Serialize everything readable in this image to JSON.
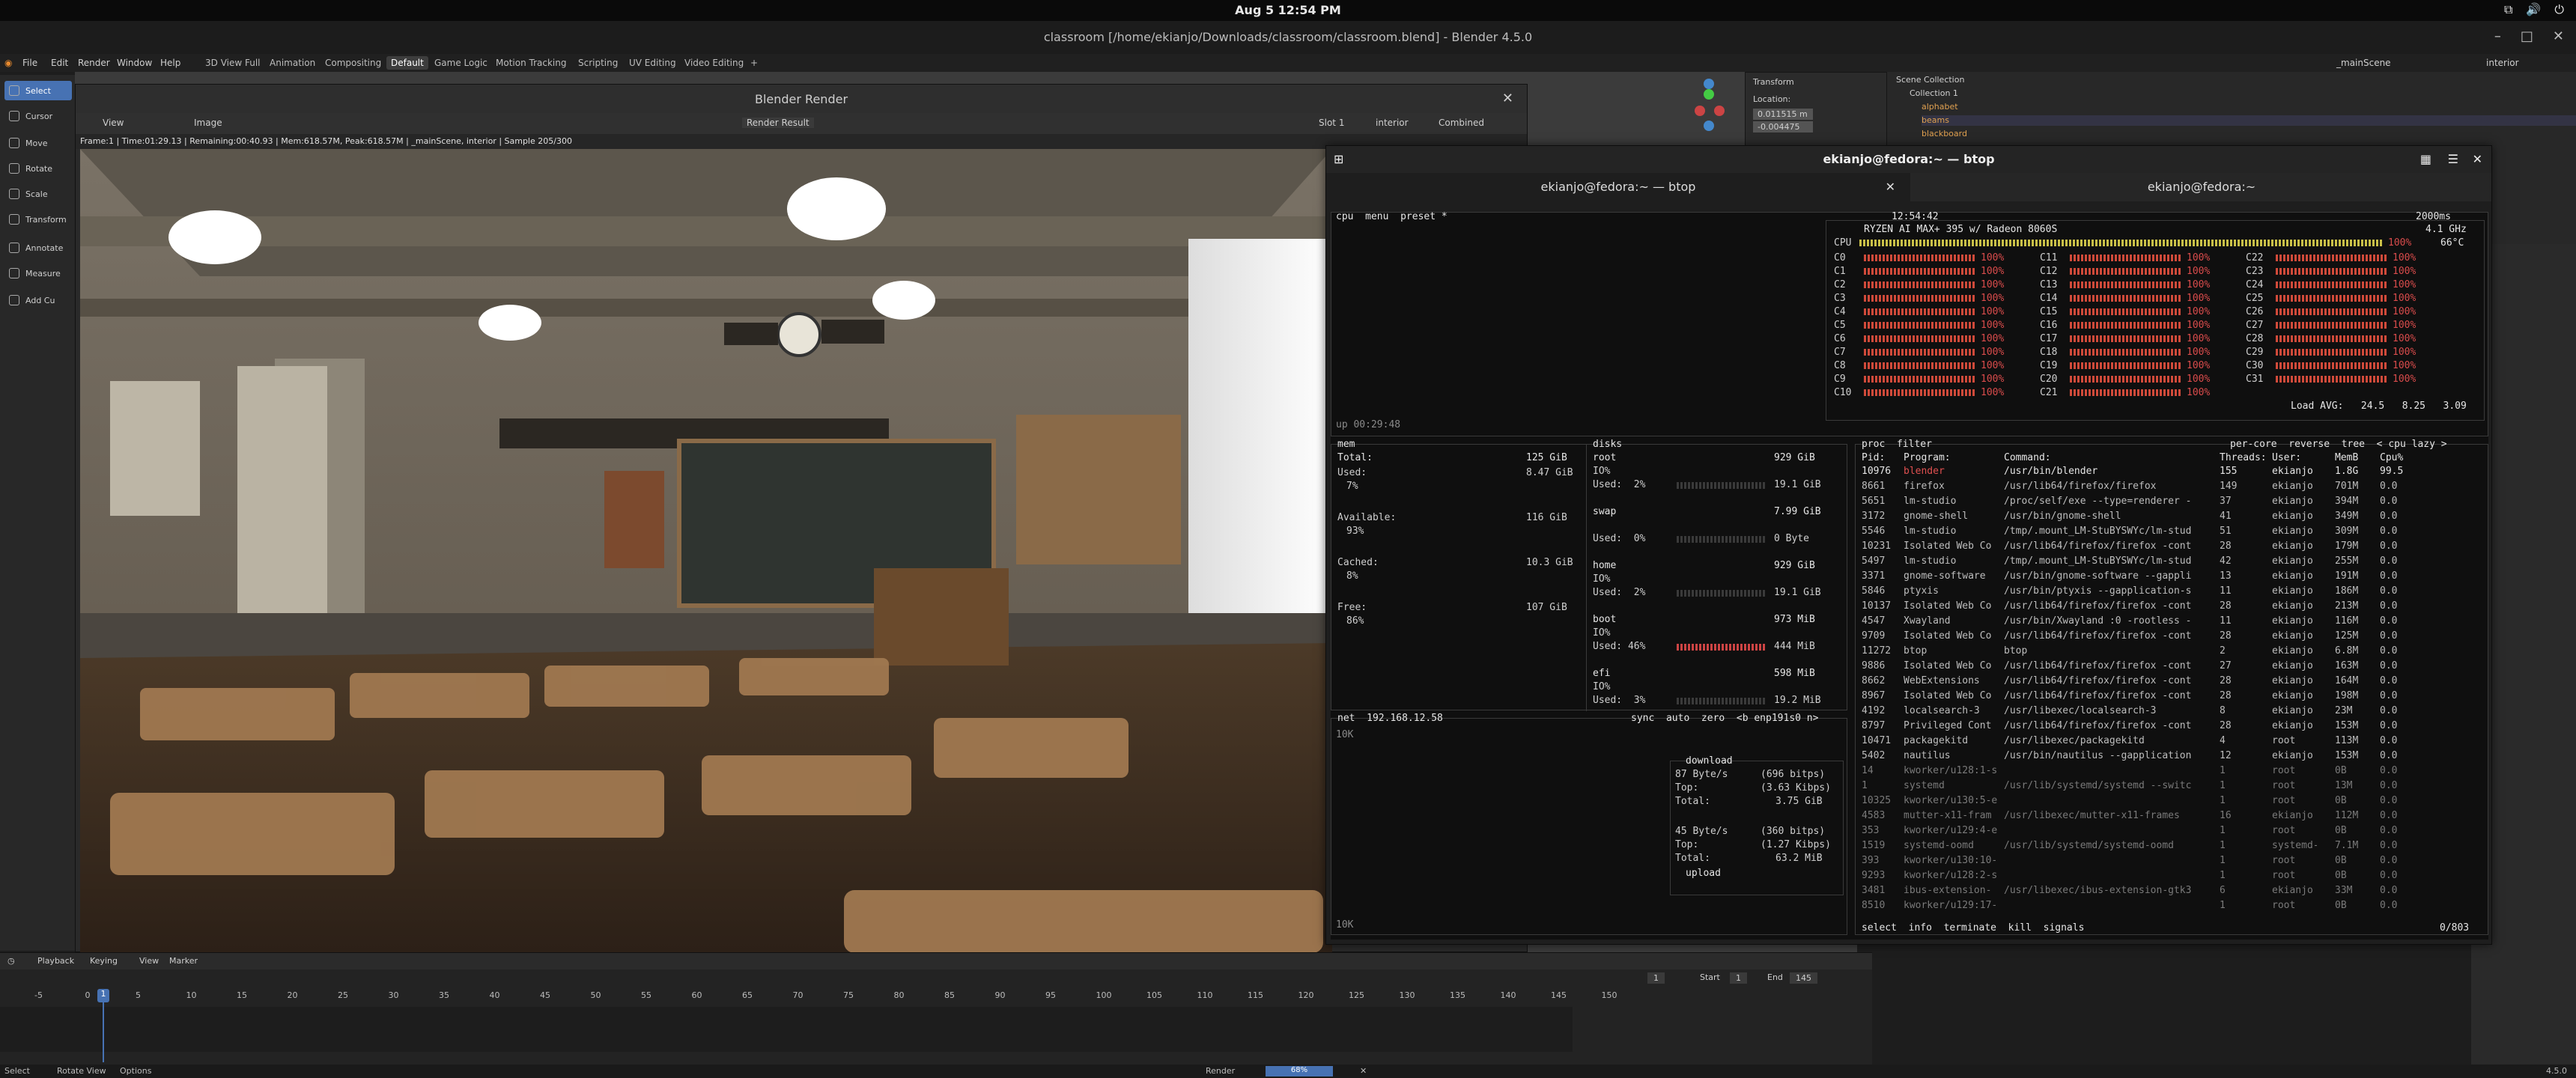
{
  "topbar": {
    "clock": "Aug 5  12:54 PM"
  },
  "blender": {
    "title": "classroom [/home/ekianjo/Downloads/classroom/classroom.blend] - Blender 4.5.0",
    "menu": [
      "File",
      "Edit",
      "Render",
      "Window",
      "Help"
    ],
    "workspaces": [
      "3D View Full",
      "Animation",
      "Compositing",
      "Default",
      "Game Logic",
      "Motion Tracking",
      "Scripting",
      "UV Editing",
      "Video Editing",
      "+"
    ],
    "active_workspace": "Default",
    "scene": "_mainScene",
    "layer": "interior",
    "tools": [
      "Select",
      "Cursor",
      "Move",
      "Rotate",
      "Scale",
      "Transform",
      "Annotate",
      "Measure",
      "Add Cu"
    ],
    "npanel": {
      "header": "Transform",
      "location": "Location:",
      "x": "0.011515 m",
      "y": "-0.004475"
    }
  },
  "render": {
    "title": "Blender Render",
    "view": "View",
    "image": "Image",
    "result": "Render Result",
    "slot": "Slot 1",
    "layer": "interior",
    "pass": "Combined",
    "info": "Frame:1 | Time:01:29.13 | Remaining:00:40.93 | Mem:618.57M, Peak:618.57M | _mainScene, interior | Sample 205/300"
  },
  "timeline": {
    "menu": [
      "Playback",
      "Keying",
      "View",
      "Marker"
    ],
    "current_frame": "1",
    "start_label": "Start",
    "start": "1",
    "end_label": "End",
    "end": "145",
    "ticks": [
      "-5",
      "0",
      "5",
      "10",
      "15",
      "20",
      "25",
      "30",
      "35",
      "40",
      "45",
      "50",
      "55",
      "60",
      "65",
      "70",
      "75",
      "80",
      "85",
      "90",
      "95",
      "100",
      "105",
      "110",
      "115",
      "120",
      "125",
      "130",
      "135",
      "140",
      "145",
      "150"
    ]
  },
  "status": {
    "select": "Select",
    "rotate": "Rotate View",
    "options": "Options",
    "render": "Render",
    "progress": "68%",
    "version": "4.5.0"
  },
  "outliner": {
    "title": "Scene Collection",
    "rows": [
      "Collection 1",
      "alphabet",
      "beams",
      "blackboard"
    ]
  },
  "terminal": {
    "title": "ekianjo@fedora:~ — btop",
    "tab1": "ekianjo@fedora:~ — btop",
    "tab2": "ekianjo@fedora:~",
    "cpu": {
      "header": "cpu  menu  preset *",
      "time": "12:54:42",
      "interval": "2000ms",
      "model": "RYZEN AI MAX+ 395 w/ Radeon 8060S",
      "freq": "4.1 GHz",
      "total": "100%",
      "temp": "66°C",
      "cores": [
        "C0",
        "C1",
        "C2",
        "C3",
        "C4",
        "C5",
        "C6",
        "C7",
        "C8",
        "C9",
        "C10",
        "C11",
        "C12",
        "C13",
        "C14",
        "C15",
        "C16",
        "C17",
        "C18",
        "C19",
        "C20",
        "C21",
        "C22",
        "C23",
        "C24",
        "C25",
        "C26",
        "C27",
        "C28",
        "C29",
        "C30",
        "C31"
      ],
      "core_pct": "100%",
      "load": "Load AVG:   24.5   8.25   3.09",
      "uptime": "up 00:29:48"
    },
    "mem": {
      "title": "mem",
      "total_l": "Total:",
      "total": "125 GiB",
      "used_l": "Used:",
      "used": "8.47 GiB",
      "used_p": "7%",
      "avail_l": "Available:",
      "avail": "116 GiB",
      "avail_p": "93%",
      "cached_l": "Cached:",
      "cached": "10.3 GiB",
      "cached_p": "8%",
      "free_l": "Free:",
      "free": "107 GiB",
      "free_p": "86%"
    },
    "disks": {
      "title": "disks",
      "rows": [
        {
          "name": "root",
          "size": "929 GiB",
          "io": "IO%",
          "used": "Used:  2%",
          "u": "19.1 GiB"
        },
        {
          "name": "swap",
          "size": "7.99 GiB",
          "io": "",
          "used": "Used:  0%",
          "u": "0 Byte"
        },
        {
          "name": "home",
          "size": "929 GiB",
          "io": "IO%",
          "used": "Used:  2%",
          "u": "19.1 GiB"
        },
        {
          "name": "boot",
          "size": "973 MiB",
          "io": "IO%",
          "used": "Used: 46%",
          "u": "444 MiB"
        },
        {
          "name": "efi",
          "size": "598 MiB",
          "io": "IO%",
          "used": "Used:  3%",
          "u": "19.2 MiB"
        }
      ]
    },
    "net": {
      "title": "net  192.168.12.58",
      "opts": "sync  auto  zero  <b enp191s0 n>",
      "scale_top": "10K",
      "scale_bot": "10K",
      "download": "download",
      "dl_rate": "87 Byte/s",
      "dl_bits": "(696 bitps)",
      "dl_top_l": "Top:",
      "dl_top": "(3.63 Kibps)",
      "dl_total_l": "Total:",
      "dl_total": "3.75 GiB",
      "ul_rate": "45 Byte/s",
      "ul_bits": "(360 bitps)",
      "ul_top_l": "Top:",
      "ul_top": "(1.27 Kibps)",
      "ul_total_l": "Total:",
      "ul_total": "63.2 MiB",
      "upload": "upload"
    },
    "proc": {
      "title": "proc  filter",
      "opts": "per-core  reverse  tree  < cpu lazy >",
      "headers": [
        "Pid:",
        "Program:",
        "Command:",
        "Threads:",
        "User:",
        "MemB",
        "Cpu%"
      ],
      "rows": [
        [
          "10976",
          "blender",
          "/usr/bin/blender",
          "155",
          "ekianjo",
          "1.8G",
          "99.5"
        ],
        [
          "8661",
          "firefox",
          "/usr/lib64/firefox/firefox",
          "149",
          "ekianjo",
          "701M",
          "0.0"
        ],
        [
          "5651",
          "lm-studio",
          "/proc/self/exe --type=renderer -",
          "37",
          "ekianjo",
          "394M",
          "0.0"
        ],
        [
          "3172",
          "gnome-shell",
          "/usr/bin/gnome-shell",
          "41",
          "ekianjo",
          "349M",
          "0.0"
        ],
        [
          "5546",
          "lm-studio",
          "/tmp/.mount_LM-StuBYSWYc/lm-stud",
          "51",
          "ekianjo",
          "309M",
          "0.0"
        ],
        [
          "10231",
          "Isolated Web Co",
          "/usr/lib64/firefox/firefox -cont",
          "28",
          "ekianjo",
          "179M",
          "0.0"
        ],
        [
          "5497",
          "lm-studio",
          "/tmp/.mount_LM-StuBYSWYc/lm-stud",
          "42",
          "ekianjo",
          "255M",
          "0.0"
        ],
        [
          "3371",
          "gnome-software",
          "/usr/bin/gnome-software --gappli",
          "13",
          "ekianjo",
          "191M",
          "0.0"
        ],
        [
          "5846",
          "ptyxis",
          "/usr/bin/ptyxis --gapplication-s",
          "11",
          "ekianjo",
          "186M",
          "0.0"
        ],
        [
          "10137",
          "Isolated Web Co",
          "/usr/lib64/firefox/firefox -cont",
          "28",
          "ekianjo",
          "213M",
          "0.0"
        ],
        [
          "4547",
          "Xwayland",
          "/usr/bin/Xwayland :0 -rootless -",
          "11",
          "ekianjo",
          "116M",
          "0.0"
        ],
        [
          "9709",
          "Isolated Web Co",
          "/usr/lib64/firefox/firefox -cont",
          "28",
          "ekianjo",
          "125M",
          "0.0"
        ],
        [
          "11272",
          "btop",
          "btop",
          "2",
          "ekianjo",
          "6.8M",
          "0.0"
        ],
        [
          "9886",
          "Isolated Web Co",
          "/usr/lib64/firefox/firefox -cont",
          "27",
          "ekianjo",
          "163M",
          "0.0"
        ],
        [
          "8662",
          "WebExtensions",
          "/usr/lib64/firefox/firefox -cont",
          "28",
          "ekianjo",
          "164M",
          "0.0"
        ],
        [
          "8967",
          "Isolated Web Co",
          "/usr/lib64/firefox/firefox -cont",
          "28",
          "ekianjo",
          "198M",
          "0.0"
        ],
        [
          "4192",
          "localsearch-3",
          "/usr/libexec/localsearch-3",
          "8",
          "ekianjo",
          "23M",
          "0.0"
        ],
        [
          "8797",
          "Privileged Cont",
          "/usr/lib64/firefox/firefox -cont",
          "28",
          "ekianjo",
          "153M",
          "0.0"
        ],
        [
          "10471",
          "packagekitd",
          "/usr/libexec/packagekitd",
          "4",
          "root",
          "113M",
          "0.0"
        ],
        [
          "5402",
          "nautilus",
          "/usr/bin/nautilus --gapplication",
          "12",
          "ekianjo",
          "153M",
          "0.0"
        ],
        [
          "14",
          "kworker/u128:1-s",
          "",
          "1",
          "root",
          "0B",
          "0.0"
        ],
        [
          "1",
          "systemd",
          "/usr/lib/systemd/systemd --switc",
          "1",
          "root",
          "13M",
          "0.0"
        ],
        [
          "10325",
          "kworker/u130:5-e",
          "",
          "1",
          "root",
          "0B",
          "0.0"
        ],
        [
          "4583",
          "mutter-x11-fram",
          "/usr/libexec/mutter-x11-frames",
          "16",
          "ekianjo",
          "112M",
          "0.0"
        ],
        [
          "353",
          "kworker/u129:4-e",
          "",
          "1",
          "root",
          "0B",
          "0.0"
        ],
        [
          "1519",
          "systemd-oomd",
          "/usr/lib/systemd/systemd-oomd",
          "1",
          "systemd-o+",
          "7.1M",
          "0.0"
        ],
        [
          "393",
          "kworker/u130:10-",
          "",
          "1",
          "root",
          "0B",
          "0.0"
        ],
        [
          "9293",
          "kworker/u128:2-s",
          "",
          "1",
          "root",
          "0B",
          "0.0"
        ],
        [
          "3481",
          "ibus-extension-",
          "/usr/libexec/ibus-extension-gtk3",
          "6",
          "ekianjo",
          "33M",
          "0.0"
        ],
        [
          "8510",
          "kworker/u129:17-",
          "",
          "1",
          "root",
          "0B",
          "0.0"
        ]
      ],
      "footer": "select  info  terminate  kill  signals",
      "count": "0/803"
    }
  }
}
